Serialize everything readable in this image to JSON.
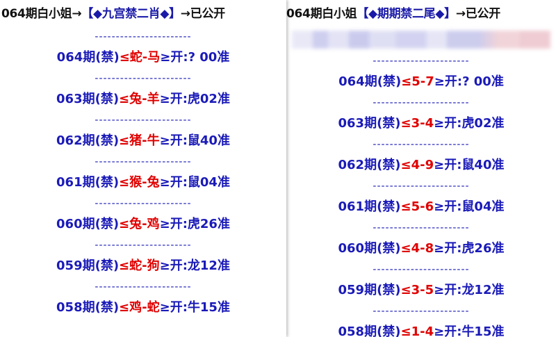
{
  "left_panel": {
    "header": {
      "prefix": "064期白小姐→",
      "highlight": "【◆九宫禁二肖◆】",
      "suffix": "→已公开"
    },
    "separator": "-----------------------",
    "rows": [
      {
        "period": "064期(禁)",
        "open": "≤",
        "picks": "蛇-马",
        "close": "≥开:",
        "result": "? 00准"
      },
      {
        "period": "063期(禁)",
        "open": "≤",
        "picks": "兔-羊",
        "close": "≥开:",
        "result": "虎02准"
      },
      {
        "period": "062期(禁)",
        "open": "≤",
        "picks": "猪-牛",
        "close": "≥开:",
        "result": "鼠40准"
      },
      {
        "period": "061期(禁)",
        "open": "≤",
        "picks": "猴-兔",
        "close": "≥开:",
        "result": "鼠04准"
      },
      {
        "period": "060期(禁)",
        "open": "≤",
        "picks": "兔-鸡",
        "close": "≥开:",
        "result": "虎26准"
      },
      {
        "period": "059期(禁)",
        "open": "≤",
        "picks": "蛇-狗",
        "close": "≥开:",
        "result": "龙12准"
      },
      {
        "period": "058期(禁)",
        "open": "≤",
        "picks": "鸡-蛇",
        "close": "≥开:",
        "result": "牛15准"
      }
    ]
  },
  "right_panel": {
    "header": {
      "prefix": "064期白小姐",
      "highlight": "【◆期期禁二尾◆】",
      "suffix": "→已公开"
    },
    "separator": "-----------------------",
    "rows": [
      {
        "period": "064期(禁)",
        "open": "≤",
        "picks": "5-7",
        "close": "≥开:",
        "result": "? 00准"
      },
      {
        "period": "063期(禁)",
        "open": "≤",
        "picks": "3-4",
        "close": "≥开:",
        "result": "虎02准"
      },
      {
        "period": "062期(禁)",
        "open": "≤",
        "picks": "4-9",
        "close": "≥开:",
        "result": "鼠40准"
      },
      {
        "period": "061期(禁)",
        "open": "≤",
        "picks": "5-6",
        "close": "≥开:",
        "result": "鼠04准"
      },
      {
        "period": "060期(禁)",
        "open": "≤",
        "picks": "4-8",
        "close": "≥开:",
        "result": "虎26准"
      },
      {
        "period": "059期(禁)",
        "open": "≤",
        "picks": "3-5",
        "close": "≥开:",
        "result": "龙12准"
      },
      {
        "period": "058期(禁)",
        "open": "≤",
        "picks": "1-4",
        "close": "≥开:",
        "result": "牛15准"
      }
    ]
  },
  "colors": {
    "blue": "#1a1ab8",
    "red": "#e00000",
    "text": "#111111"
  }
}
